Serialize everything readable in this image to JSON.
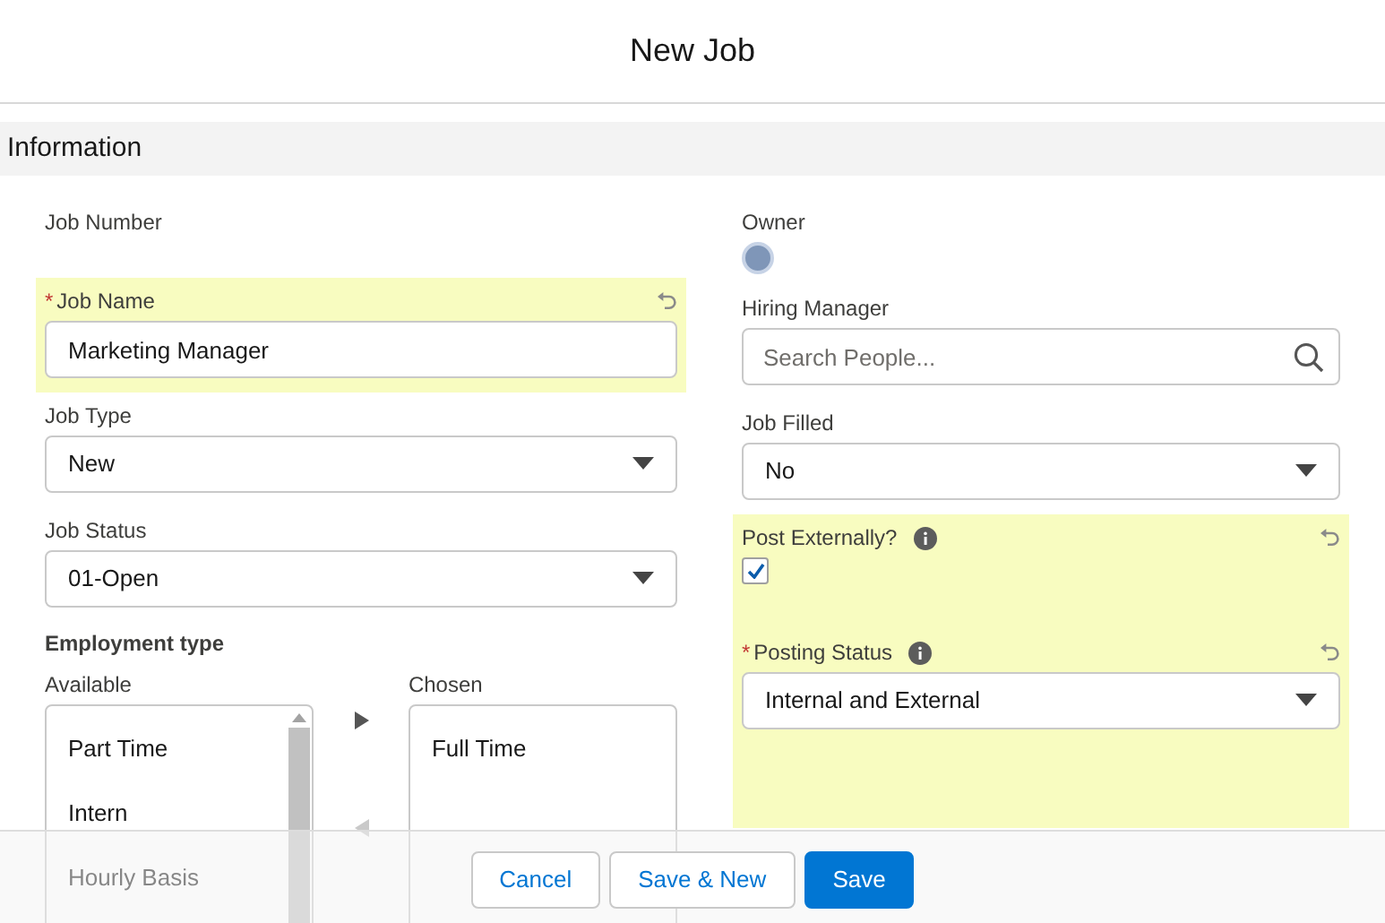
{
  "modal": {
    "title": "New Job"
  },
  "section": {
    "title": "Information"
  },
  "left_fields": [
    {
      "kind": "readonly",
      "label": "Job Number",
      "edited": false
    },
    {
      "kind": "text",
      "label": "Job Name",
      "required_mark": "*",
      "edited": true,
      "value": "Marketing Manager"
    },
    {
      "kind": "select",
      "label": "Job Type",
      "edited": false,
      "value": "New"
    },
    {
      "kind": "select",
      "label": "Job Status",
      "edited": false,
      "value": "01-Open"
    }
  ],
  "employment_type": {
    "title": "Employment type",
    "available_label": "Available",
    "chosen_label": "Chosen",
    "available": [
      "Part Time",
      "Intern",
      "Hourly Basis"
    ],
    "chosen": [
      "Full Time"
    ]
  },
  "right_fields": [
    {
      "kind": "owner",
      "label": "Owner",
      "edited": false
    },
    {
      "kind": "lookup",
      "label": "Hiring Manager",
      "edited": false,
      "placeholder": "Search People..."
    },
    {
      "kind": "select",
      "label": "Job Filled",
      "edited": false,
      "value": "No"
    },
    {
      "kind": "checkbox",
      "label": "Post Externally?",
      "edited": true,
      "info": true,
      "checked": true
    },
    {
      "kind": "select",
      "label": "Posting Status",
      "required_mark": "*",
      "edited": true,
      "info": true,
      "value": "Internal and External"
    }
  ],
  "footer": {
    "buttons": [
      {
        "label": "Cancel",
        "kind": "neutral"
      },
      {
        "label": "Save & New",
        "kind": "neutral"
      },
      {
        "label": "Save",
        "kind": "brand"
      }
    ]
  }
}
